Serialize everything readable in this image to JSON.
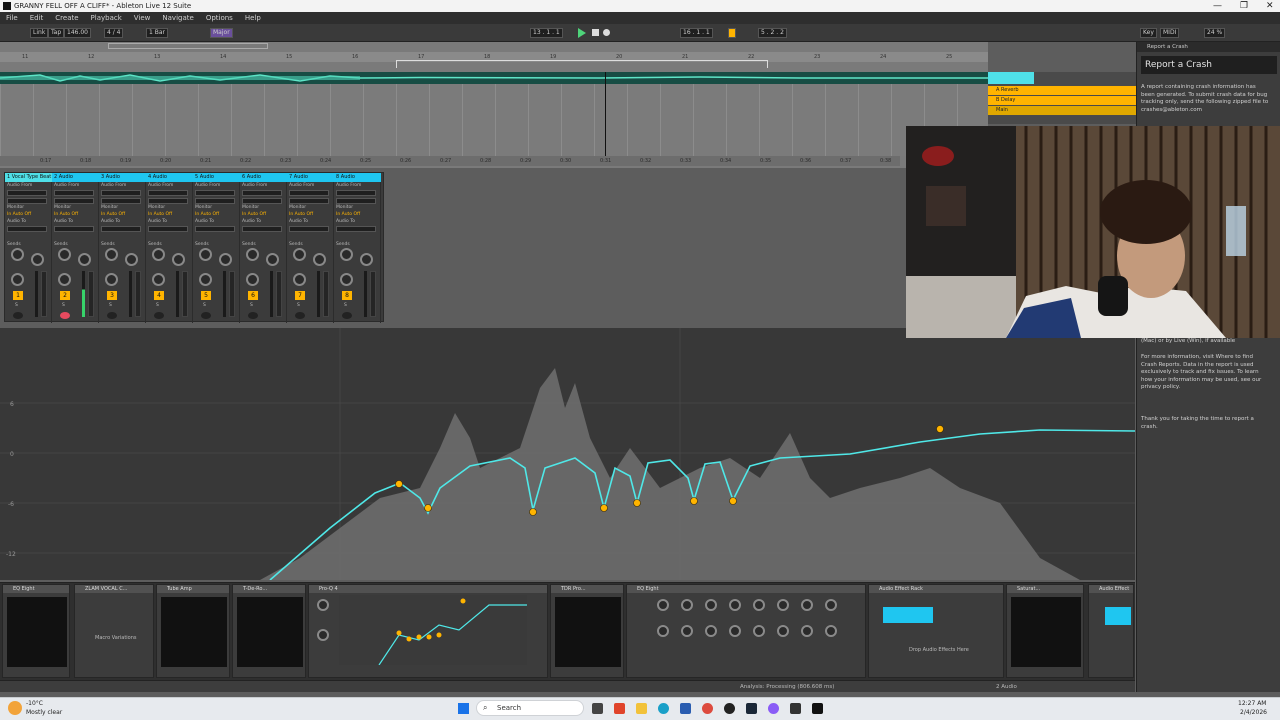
{
  "window": {
    "title": "GRANNY FELL OFF A CLIFF* - Ableton Live 12 Suite",
    "controls": [
      "—",
      "❐",
      "✕"
    ]
  },
  "menu": [
    "File",
    "Edit",
    "Create",
    "Playback",
    "View",
    "Navigate",
    "Options",
    "Help"
  ],
  "transport": {
    "link": "Link",
    "tap": "Tap",
    "tempo": "146.00",
    "time_signature": "4 / 4",
    "quantize": "1 Bar",
    "key": "Major",
    "position": "13 . 1 . 1",
    "loop_start": "16 . 1 . 1",
    "loop_length": "5 . 2 . 2",
    "cpu": "24 %",
    "key_label": "Key",
    "midi_label": "MIDI"
  },
  "arrangement": {
    "ruler_bars": [
      "11",
      "12",
      "13",
      "14",
      "15",
      "16",
      "17",
      "18",
      "19",
      "20",
      "21",
      "22",
      "23",
      "24",
      "25"
    ],
    "time_marks": [
      "0:17",
      "0:18",
      "0:19",
      "0:20",
      "0:21",
      "0:22",
      "0:23",
      "0:24",
      "0:25",
      "0:26",
      "0:27",
      "0:28",
      "0:29",
      "0:30",
      "0:31",
      "0:32",
      "0:33",
      "0:34",
      "0:35",
      "0:36",
      "0:37",
      "0:38"
    ],
    "tracks": [
      {
        "name": "A Reverb",
        "color": "#ffb400"
      },
      {
        "name": "B Delay",
        "color": "#ffb400"
      },
      {
        "name": "Main",
        "color": "#e0a800"
      }
    ]
  },
  "mixer": {
    "strips": [
      {
        "name": "1 Vocal Type Beat",
        "number": "1"
      },
      {
        "name": "2 Audio",
        "number": "2"
      },
      {
        "name": "3 Audio",
        "number": "3"
      },
      {
        "name": "4 Audio",
        "number": "4"
      },
      {
        "name": "5 Audio",
        "number": "5"
      },
      {
        "name": "6 Audio",
        "number": "6"
      },
      {
        "name": "7 Audio",
        "number": "7"
      },
      {
        "name": "8 Audio",
        "number": "8"
      }
    ],
    "audio_from": "Audio From",
    "ext_in": "Ext. In",
    "monitor": "Monitor",
    "monitor_modes": [
      "In",
      "Auto",
      "Off"
    ],
    "audio_to": "Audio To",
    "main": "Main",
    "sends": "Sends"
  },
  "eq": {
    "db_labels": [
      "6",
      "0",
      "-6",
      "-12"
    ]
  },
  "crash_panel": {
    "bar_title": "Report a Crash",
    "heading": "Report a Crash",
    "para1": "A report containing crash information has been generated. To submit crash data for bug tracking only, send the following zipped file to crashes@ableton.com",
    "para2": "(Mac) or by Live (Win), if available",
    "para3": "For more information, visit Where to find Crash Reports. Data in the report is used exclusively to track and fix issues. To learn how your information may be used, see our privacy policy.",
    "para4": "Thank you for taking the time to report a crash."
  },
  "devices": [
    {
      "name": "EQ Eight"
    },
    {
      "name": "ZLAM VOCAL C..."
    },
    {
      "name": "Tube Amp"
    },
    {
      "name": "T-De-Ro..."
    },
    {
      "name": "Pro-Q 4"
    },
    {
      "name": "TDR Pro..."
    },
    {
      "name": "EQ Eight"
    },
    {
      "name": "Audio Effect Rack"
    },
    {
      "name": "Saturat..."
    },
    {
      "name": "Audio Effect"
    }
  ],
  "device_labels": {
    "macro_variations": "Macro Variations",
    "drop_audio": "Drop Audio Effects Here",
    "status": "Analysis: Processing (806.608 ms)",
    "audio_track": "2 Audio"
  },
  "taskbar": {
    "weather_temp": "-10°C",
    "weather_desc": "Mostly clear",
    "search": "Search",
    "time": "12:27 AM",
    "date": "2/4/2026"
  }
}
